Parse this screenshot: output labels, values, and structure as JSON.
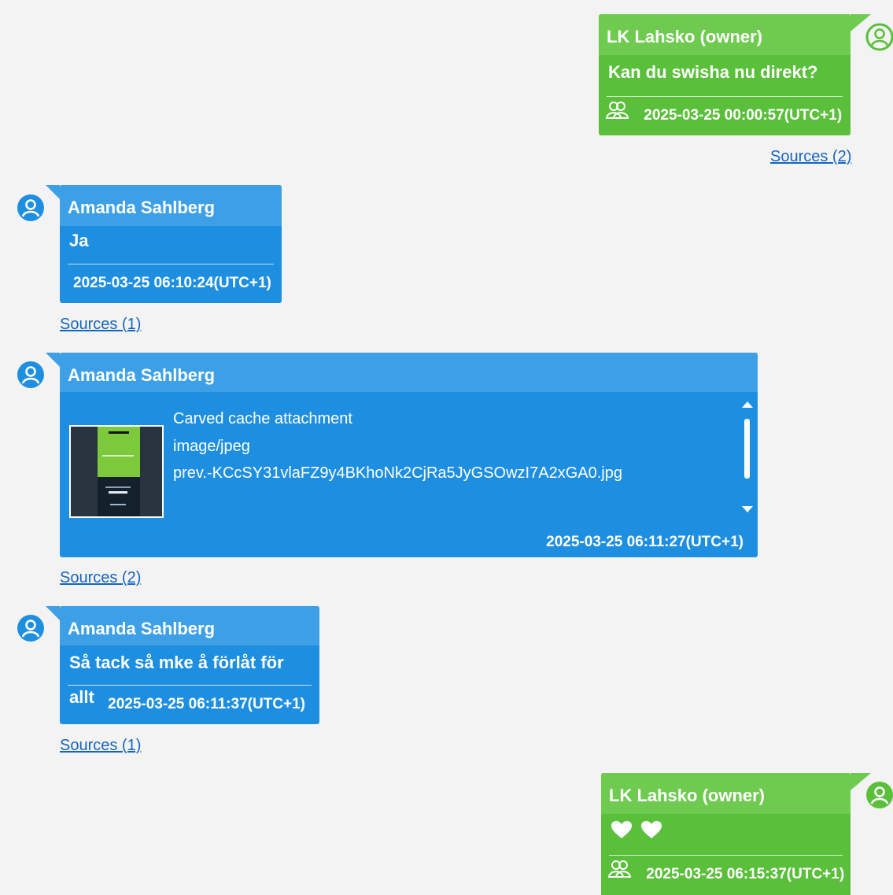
{
  "messages": [
    {
      "sender": "LK Lahsko (owner)",
      "text": "Kan du swisha nu direkt?",
      "timestamp": "2025-03-25 00:00:57(UTC+1)",
      "sources": "Sources (2)",
      "side": "right",
      "color": "#5abf3a"
    },
    {
      "sender": "Amanda Sahlberg",
      "text": "Ja",
      "timestamp": "2025-03-25 06:10:24(UTC+1)",
      "sources": "Sources (1)",
      "side": "left",
      "color": "#1e8fe0"
    },
    {
      "sender": "Amanda Sahlberg",
      "attachment": {
        "title": "Carved cache attachment",
        "mime": "image/jpeg",
        "filename": "prev.-KCcSY31vlaFZ9y4BKhoNk2CjRa5JyGSOwzI7A2xGA0.jpg"
      },
      "timestamp": "2025-03-25 06:11:27(UTC+1)",
      "sources": "Sources (2)",
      "side": "left",
      "color": "#1e8fe0"
    },
    {
      "sender": "Amanda Sahlberg",
      "text": "Så tack så mke å förlåt för allt",
      "timestamp": "2025-03-25 06:11:37(UTC+1)",
      "sources": "Sources (1)",
      "side": "left",
      "color": "#1e8fe0"
    },
    {
      "sender": "LK Lahsko (owner)",
      "text": "",
      "emoji": [
        "white-heart",
        "white-heart"
      ],
      "timestamp": "2025-03-25 06:15:37(UTC+1)",
      "side": "right",
      "color": "#5abf3a"
    }
  ],
  "icons": {
    "avatar": "user-circle-icon",
    "group": "group-icon",
    "scroll": "scrollbar"
  }
}
